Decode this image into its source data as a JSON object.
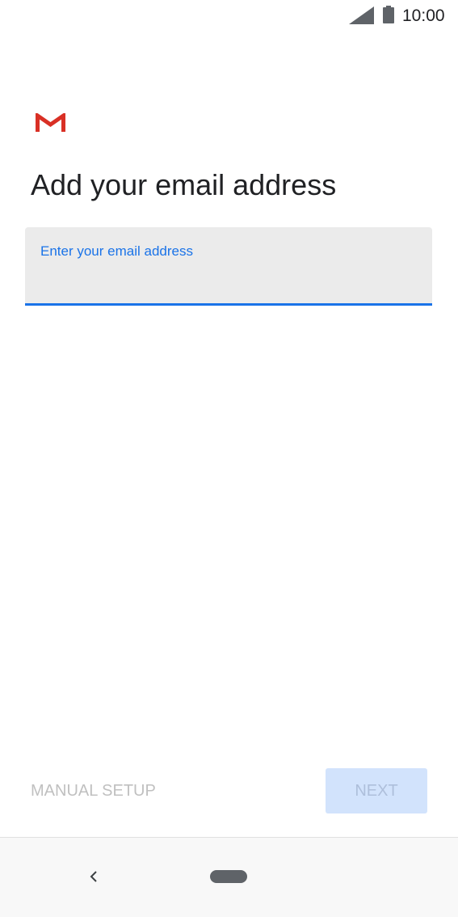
{
  "status_bar": {
    "time": "10:00",
    "icons": [
      "signal-icon",
      "battery-icon"
    ]
  },
  "logo": "gmail-logo",
  "title": "Add your email address",
  "email_field": {
    "label": "Enter your email address",
    "value": "",
    "placeholder": ""
  },
  "actions": {
    "manual_setup_label": "MANUAL SETUP",
    "next_label": "NEXT"
  },
  "nav_bar": {
    "icons": [
      "back-icon",
      "home-pill"
    ]
  },
  "colors": {
    "accent": "#1a73e8",
    "field_background": "#ebebeb",
    "next_disabled_bg": "#d2e3fc",
    "gmail_red": "#d93025"
  }
}
